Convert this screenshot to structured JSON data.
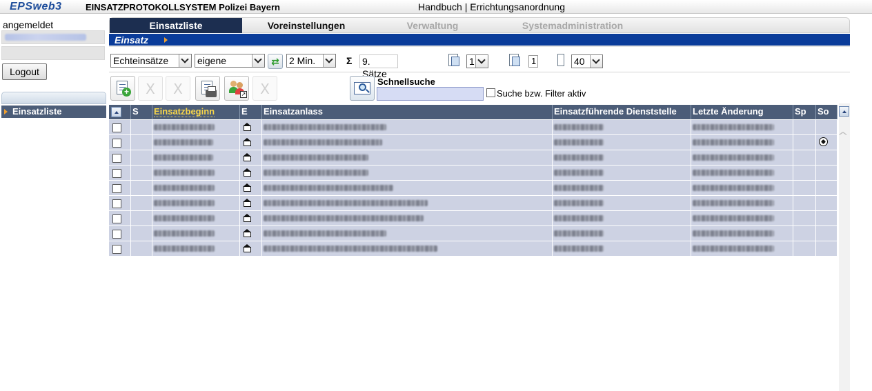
{
  "header": {
    "logo": "EPSweb3",
    "app_title": "EINSATZPROTOKOLLSYSTEM Polizei Bayern",
    "link_handbuch": "Handbuch",
    "link_sep": " | ",
    "link_errichtung": "Errichtungsanordnung"
  },
  "sidebar": {
    "login_label": "angemeldet",
    "logout_label": "Logout",
    "nav_item": "Einsatzliste"
  },
  "tabs": [
    {
      "label": "Einsatzliste",
      "state": "active"
    },
    {
      "label": "Voreinstellungen",
      "state": "normal"
    },
    {
      "label": "Verwaltung",
      "state": "disabled"
    },
    {
      "label": "Systemadministration",
      "state": "disabled"
    }
  ],
  "section": {
    "title": "Einsatz"
  },
  "controls": {
    "type_select": "Echteinsätze",
    "owner_select": "eigene",
    "refresh_select": "2 Min.",
    "sigma": "Σ",
    "record_count": "9. Sätze",
    "page_select": "1",
    "page_total": "1",
    "rows_select": "40"
  },
  "search": {
    "label": "Schnellsuche",
    "value": "",
    "filter_label": "Suche bzw. Filter aktiv"
  },
  "toolbar_icons": [
    "new-entry-icon",
    "delete-icon",
    "delete-icon",
    "print-icon",
    "assign-users-icon",
    "delete-icon",
    "quick-search-icon"
  ],
  "table": {
    "columns": {
      "s": "S",
      "einsatzbeginn": "Einsatzbeginn",
      "e": "E",
      "einsatzanlass": "Einsatzanlass",
      "dienststelle": "Einsatzführende Dienststelle",
      "aenderung": "Letzte Änderung",
      "sp": "Sp",
      "so": "So"
    },
    "rows": [
      {
        "so_icon": ""
      },
      {
        "so_icon": "football-icon"
      },
      {
        "so_icon": ""
      },
      {
        "so_icon": ""
      },
      {
        "so_icon": ""
      },
      {
        "so_icon": ""
      },
      {
        "so_icon": ""
      },
      {
        "so_icon": ""
      },
      {
        "so_icon": ""
      }
    ]
  },
  "colors": {
    "accent_blue": "#0a3c9a",
    "header_slate": "#4c5d78",
    "row_bg": "#cdd2e3",
    "sort_highlight": "#f7d64a"
  }
}
